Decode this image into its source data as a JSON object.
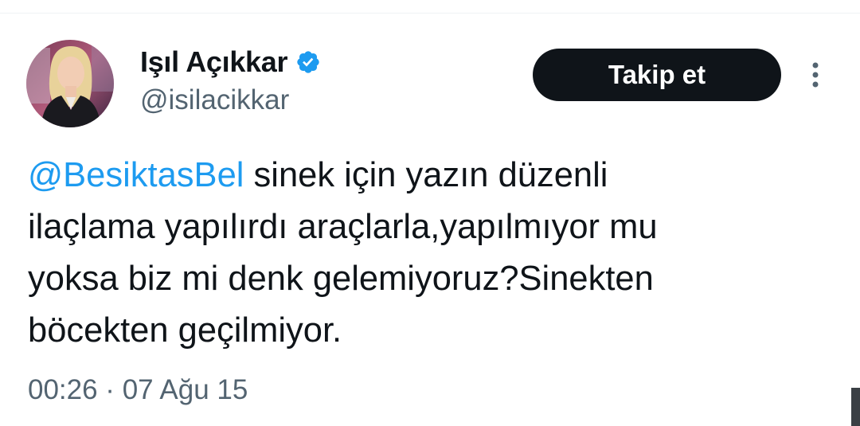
{
  "author": {
    "display_name": "Işıl Açıkkar",
    "handle": "@isilacikkar",
    "verified": true,
    "verified_icon": "verified-badge-icon",
    "verified_color": "#1d9bf0"
  },
  "follow_button": {
    "label": "Takip et"
  },
  "more_icon": "more-vertical-icon",
  "tweet": {
    "mention": "@BesiktasBel",
    "line1_rest": " sinek için yazın düzenli",
    "line2": "ilaçlama yapılırdı araçlarla,yapılmıyor mu",
    "line3": "yoksa biz mi denk gelemiyoruz?Sinekten",
    "line4": "böcekten geçilmiyor."
  },
  "timestamp": "00:26 · 07 Ağu 15",
  "colors": {
    "text": "#0f1419",
    "secondary": "#536471",
    "link": "#1d9bf0",
    "button_bg": "#0f1419",
    "button_text": "#ffffff"
  }
}
